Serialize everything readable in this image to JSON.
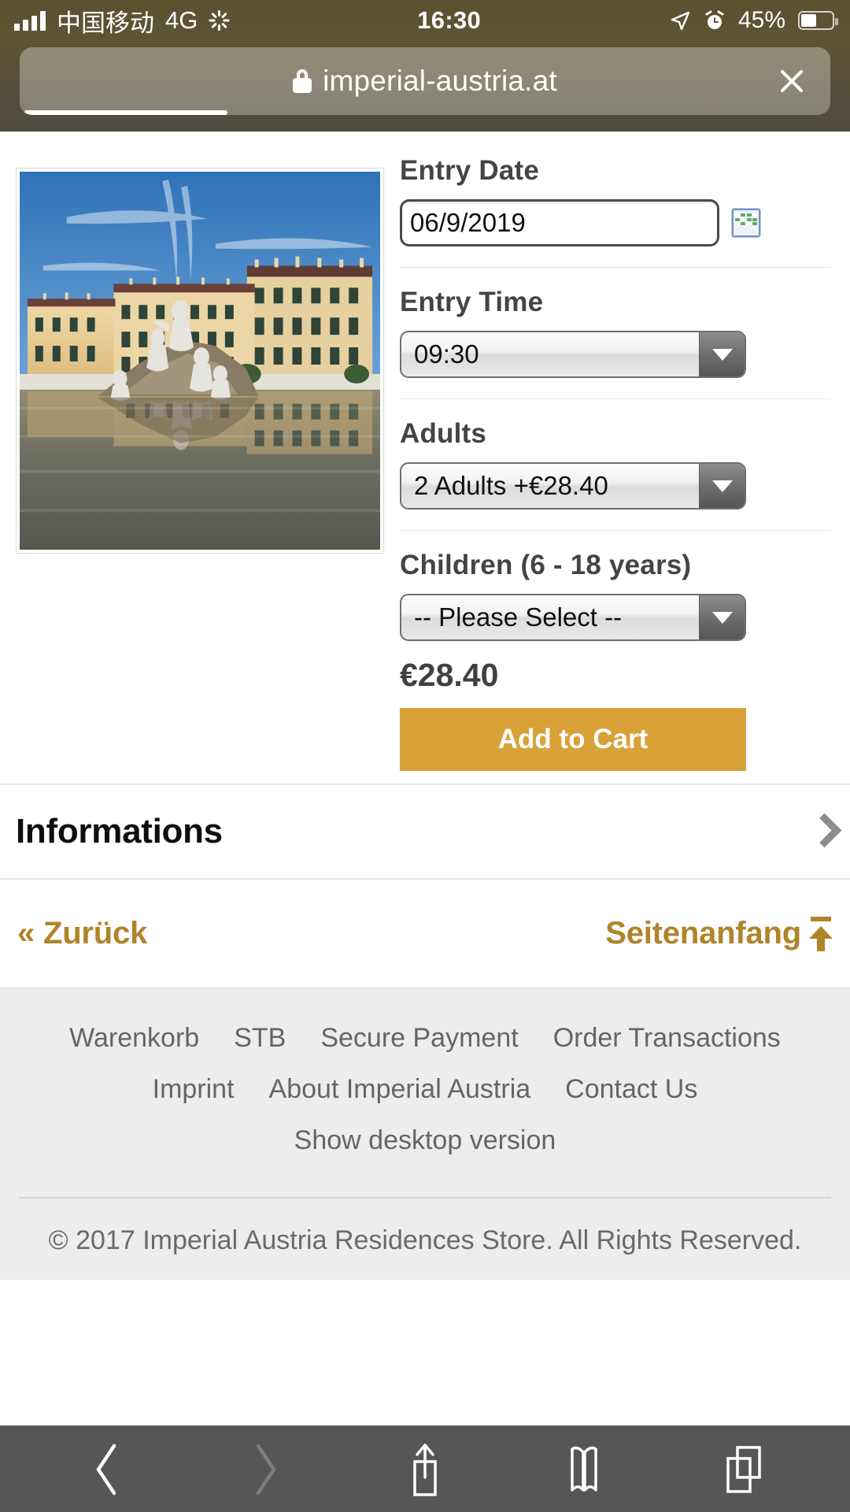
{
  "status_bar": {
    "signal_icon": "cellular-bars-icon",
    "carrier": "中国移动",
    "network": "4G",
    "sync_icon": "activity-spinner-icon",
    "time": "16:30",
    "location_icon": "location-arrow-icon",
    "alarm_icon": "alarm-clock-icon",
    "battery_percent": "45%",
    "battery_icon": "battery-icon"
  },
  "browser": {
    "lock_icon": "lock-icon",
    "url": "imperial-austria.at",
    "close_label": "✕",
    "close_icon": "close-icon",
    "loading_progress": "25%"
  },
  "product": {
    "image_alt": "Schonbrunn Palace with Neptune Fountain reflected in water",
    "fields": [
      {
        "label": "Entry Date",
        "type": "date",
        "value": "06/9/2019",
        "icon": "calendar-icon"
      },
      {
        "label": "Entry Time",
        "type": "select",
        "value": "09:30"
      },
      {
        "label": "Adults",
        "type": "select",
        "value": "2 Adults +€28.40"
      },
      {
        "label": "Children (6 - 18 years)",
        "type": "select",
        "value": "-- Please Select --"
      }
    ],
    "price": "€28.40",
    "add_to_cart_label": "Add to Cart",
    "accent_color": "#d9a238"
  },
  "informations": {
    "title": "Informations",
    "chevron_icon": "chevron-right-icon"
  },
  "pager": {
    "back_label": "« Zurück",
    "top_label": "Seitenanfang",
    "top_icon": "arrow-up-to-line-icon",
    "link_color": "#b0842a"
  },
  "footer": {
    "rows": [
      [
        "Warenkorb",
        "STB",
        "Secure Payment",
        "Order Transactions"
      ],
      [
        "Imprint",
        "About Imperial Austria",
        "Contact Us"
      ],
      [
        "Show desktop version"
      ]
    ],
    "copyright": "© 2017 Imperial Austria Residences Store. All Rights Reserved."
  },
  "toolbar": {
    "buttons": [
      {
        "name": "back-icon",
        "enabled": true
      },
      {
        "name": "forward-icon",
        "enabled": false
      },
      {
        "name": "share-icon",
        "enabled": true
      },
      {
        "name": "bookmarks-icon",
        "enabled": true
      },
      {
        "name": "tabs-icon",
        "enabled": true
      }
    ]
  }
}
